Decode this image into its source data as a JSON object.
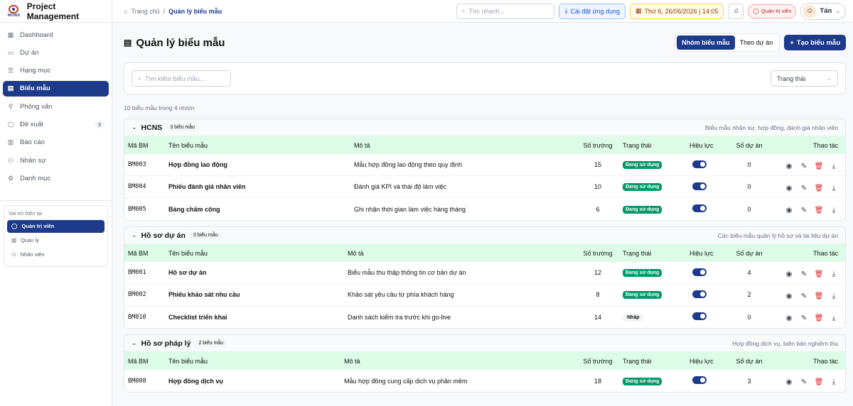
{
  "brand": {
    "logo_text": "WOWS",
    "name": "Project Management"
  },
  "sidebar": {
    "items": [
      {
        "icon": "dashboard-icon",
        "label": "Dashboard",
        "active": false,
        "badge": ""
      },
      {
        "icon": "folder-icon",
        "label": "Dự án",
        "active": false,
        "badge": ""
      },
      {
        "icon": "list-icon",
        "label": "Hạng mục",
        "active": false,
        "badge": ""
      },
      {
        "icon": "form-icon",
        "label": "Biểu mẫu",
        "active": true,
        "badge": ""
      },
      {
        "icon": "link-icon",
        "label": "Phỏng vấn",
        "active": false,
        "badge": ""
      },
      {
        "icon": "chat-icon",
        "label": "Đề xuất",
        "active": false,
        "badge": "3"
      },
      {
        "icon": "chart-icon",
        "label": "Báo cáo",
        "active": false,
        "badge": ""
      },
      {
        "icon": "people-icon",
        "label": "Nhân sự",
        "active": false,
        "badge": ""
      },
      {
        "icon": "gear-icon",
        "label": "Danh mục",
        "active": false,
        "badge": ""
      }
    ],
    "role_title": "Vai trò hiện tại",
    "roles": [
      {
        "label": "Quản trị viên",
        "active": true
      },
      {
        "label": "Quản lý",
        "active": false
      },
      {
        "label": "Nhân viên",
        "active": false
      }
    ]
  },
  "topbar": {
    "breadcrumb_home": "Trang chủ",
    "breadcrumb_sep": "/",
    "breadcrumb_current": "Quản lý biểu mẫu",
    "search_placeholder": "Tìm nhanh...",
    "install_label": "Cài đặt ứng dụng",
    "date_label": "Thứ 6, 26/06/2026 | 14:05",
    "role_label": "Quản trị viên",
    "user_name": "Tấn"
  },
  "page": {
    "title": "Quản lý biểu mẫu",
    "seg_group": "Nhóm biểu mẫu",
    "seg_project": "Theo dự án",
    "create_label": "Tạo biểu mẫu",
    "filter_placeholder": "Tìm kiếm biểu mẫu...",
    "status_select": "Trạng thái",
    "summary": "10 biểu mẫu trong 4 nhóm"
  },
  "columns": {
    "code": "Mã BM",
    "name": "Tên biểu mẫu",
    "desc": "Mô tả",
    "fields": "Số trường",
    "status": "Trạng thái",
    "active": "Hiệu lực",
    "projects": "Số dự án",
    "actions": "Thao tác"
  },
  "groups": [
    {
      "name": "HCNS",
      "count": "3 biểu mẫu",
      "desc": "Biểu mẫu nhân sự, hợp đồng, đánh giá nhân viên",
      "cols": "57px 261px 318px 60px 94px 68px 42px 1fr",
      "rows": [
        {
          "code": "BM003",
          "name": "Hợp đồng lao động",
          "desc": "Mẫu hợp đồng lao động theo quy định",
          "fields": "15",
          "status": "Đang sử dụng",
          "status_type": "on",
          "projects": "0"
        },
        {
          "code": "BM004",
          "name": "Phiếu đánh giá nhân viên",
          "desc": "Đánh giá KPI và thái độ làm việc",
          "fields": "10",
          "status": "Đang sử dụng",
          "status_type": "on",
          "projects": "0"
        },
        {
          "code": "BM005",
          "name": "Bảng chấm công",
          "desc": "Ghi nhận thời gian làm việc hàng tháng",
          "fields": "6",
          "status": "Đang sử dụng",
          "status_type": "on",
          "projects": "0"
        }
      ]
    },
    {
      "name": "Hồ sơ dự án",
      "count": "3 biểu mẫu",
      "desc": "Các biểu mẫu quản lý hồ sơ và tài liệu dự án",
      "cols": "57px 252px 327px 60px 94px 68px 42px 1fr",
      "rows": [
        {
          "code": "BM001",
          "name": "Hồ sơ dự án",
          "desc": "Biểu mẫu thu thập thông tin cơ bản dự án",
          "fields": "12",
          "status": "Đang sử dụng",
          "status_type": "on",
          "projects": "4"
        },
        {
          "code": "BM002",
          "name": "Phiếu khảo sát nhu cầu",
          "desc": "Khảo sát yêu cầu từ phía khách hàng",
          "fields": "8",
          "status": "Đang sử dụng",
          "status_type": "on",
          "projects": "2"
        },
        {
          "code": "BM010",
          "name": "Checklist triển khai",
          "desc": "Danh sách kiểm tra trước khi go-live",
          "fields": "14",
          "status": "Nháp",
          "status_type": "draft",
          "projects": "0"
        }
      ]
    },
    {
      "name": "Hồ sơ pháp lý",
      "count": "2 biểu mẫu",
      "desc": "Hợp đồng dịch vụ, biên bản nghiệm thu",
      "cols": "57px 247px 332px 60px 94px 68px 42px 1fr",
      "rows": [
        {
          "code": "BM008",
          "name": "Hợp đồng dịch vụ",
          "desc": "Mẫu hợp đồng cung cấp dịch vụ phần mềm",
          "fields": "18",
          "status": "Đang sử dụng",
          "status_type": "on",
          "projects": "3"
        }
      ]
    }
  ]
}
